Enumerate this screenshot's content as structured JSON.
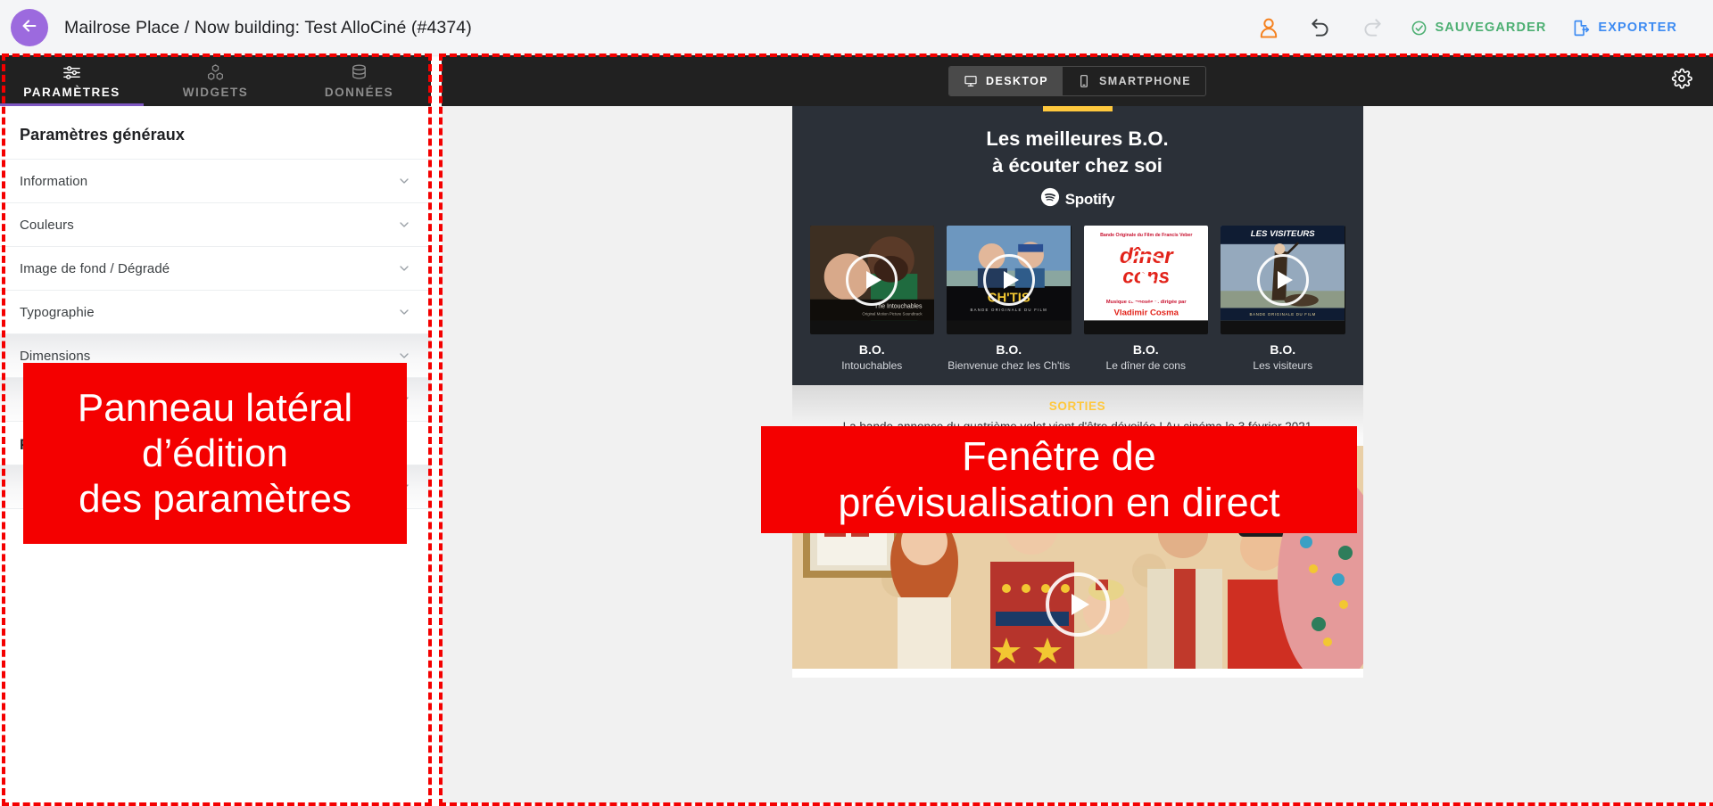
{
  "topbar": {
    "back_icon": "arrow-left-icon",
    "title": "Mailrose Place / Now building: Test AlloCiné (#4374)",
    "account_icon": "account-circle-icon",
    "undo_icon": "undo-icon",
    "redo_icon": "redo-icon",
    "save_label": "SAUVEGARDER",
    "save_icon": "check-circle-icon",
    "save_color": "#4caf72",
    "export_label": "EXPORTER",
    "export_icon": "file-export-icon",
    "export_color": "#3d8bf2"
  },
  "sidebar": {
    "tabs": [
      {
        "label": "PARAMÈTRES",
        "icon": "sliders-icon",
        "active": true
      },
      {
        "label": "WIDGETS",
        "icon": "blocks-icon",
        "active": false
      },
      {
        "label": "DONNÉES",
        "icon": "database-icon",
        "active": false
      }
    ],
    "active_tab_color": "#7e57c2",
    "panel_title": "Paramètres généraux",
    "accordions": [
      {
        "label": "Information",
        "icon": "chevron-down-icon"
      },
      {
        "label": "Couleurs",
        "icon": "chevron-down-icon"
      },
      {
        "label": "Image de fond / Dégradé",
        "icon": "chevron-down-icon"
      },
      {
        "label": "Typographie",
        "icon": "chevron-down-icon"
      },
      {
        "label": "Dimensions",
        "icon": "chevron-down-icon"
      },
      {
        "label": "",
        "icon": "chevron-down-icon"
      }
    ],
    "section_title": "P",
    "accordions2": [
      {
        "label": "",
        "icon": "chevron-down-icon"
      }
    ]
  },
  "preview": {
    "devices": [
      {
        "label": "DESKTOP",
        "icon": "monitor-icon",
        "active": true
      },
      {
        "label": "SMARTPHONE",
        "icon": "phone-icon",
        "active": false
      }
    ],
    "gear_icon": "gear-icon",
    "newsletter": {
      "accent_color": "#ffc83d",
      "header_line1": "Les meilleures B.O.",
      "header_line2": "à écouter chez soi",
      "brand": "Spotify",
      "brand_icon": "spotify-icon",
      "items": [
        {
          "caption": "B.O.",
          "subtitle": "Intouchables",
          "art": "the-intouchables",
          "play_icon": "play-icon"
        },
        {
          "caption": "B.O.",
          "subtitle": "Bienvenue chez les Ch'tis",
          "art": "bienvenue-chez-les-chtis",
          "play_icon": "play-icon"
        },
        {
          "caption": "B.O.",
          "subtitle": "Le dîner de cons",
          "art": "le-diner-de-cons",
          "play_icon": "play-icon"
        },
        {
          "caption": "B.O.",
          "subtitle": "Les visiteurs",
          "art": "les-visiteurs",
          "play_icon": "play-icon"
        }
      ],
      "section_kicker": "SORTIES",
      "section_desc": "La bande-annonce du quatrième volet vient d'être dévoilée ! Au cinéma le 3 février 2021",
      "big_image_alt": "famille-noel-photo",
      "big_play_icon": "play-icon"
    }
  },
  "annotations": {
    "color": "#f40000",
    "left_box": "Panneau latéral\nd’édition\ndes paramètres",
    "left_box_lines": [
      "Panneau latéral",
      "d’édition",
      "des paramètres"
    ],
    "right_box": "Fenêtre de\nprévisualisation en direct",
    "right_box_lines": [
      "Fenêtre de",
      "prévisualisation en direct"
    ]
  }
}
